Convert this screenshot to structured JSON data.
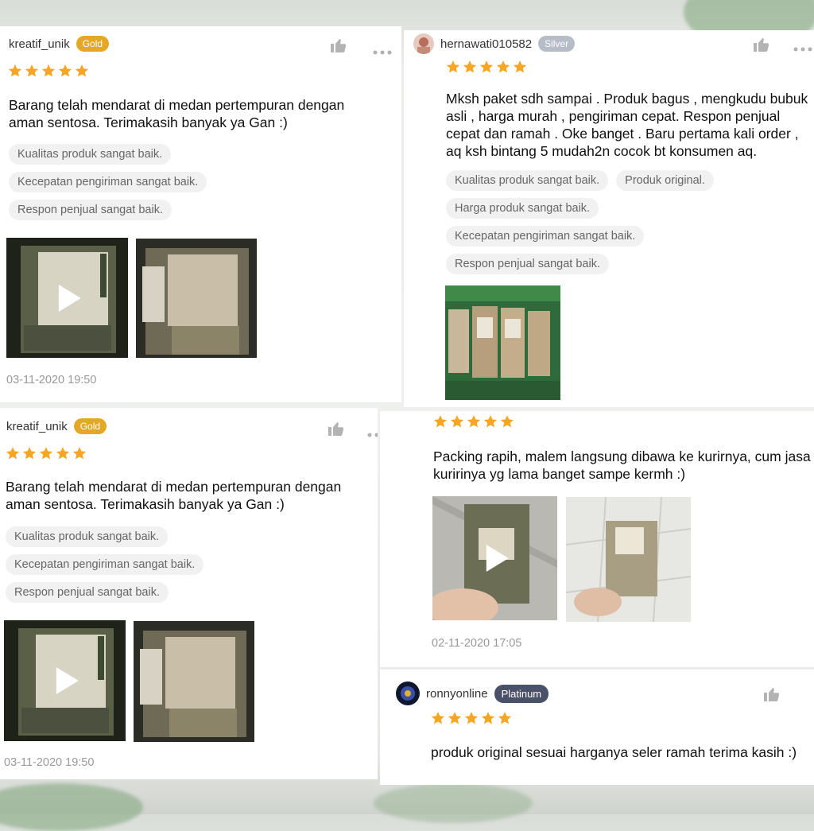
{
  "reviews": [
    {
      "user": "kreatif_unik",
      "badge": "Gold",
      "rating": 5,
      "text": "Barang telah mendarat di medan pertempuran dengan aman sentosa. Terimakasih banyak ya Gan :)",
      "tags": [
        "Kualitas produk sangat baik.",
        "Kecepatan pengiriman sangat baik.",
        "Respon penjual sangat baik."
      ],
      "date": "03-11-2020 19:50"
    },
    {
      "user": "hernawati010582",
      "badge": "Silver",
      "rating": 5,
      "text": "Mksh paket sdh sampai . Produk bagus  , mengkudu bubuk asli , harga murah ,  pengiriman cepat. Respon penjual cepat dan ramah . Oke banget .  Baru pertama kali order , aq ksh bintang 5 mudah2n cocok bt konsumen aq.",
      "tags": [
        "Kualitas produk sangat baik.",
        "Produk original.",
        "Harga produk sangat baik.",
        "Kecepatan pengiriman sangat baik.",
        "Respon penjual sangat baik."
      ]
    },
    {
      "user": "kreatif_unik",
      "badge": "Gold",
      "rating": 5,
      "text": "Barang telah mendarat di medan pertempuran dengan aman sentosa. Terimakasih banyak ya Gan :)",
      "tags": [
        "Kualitas produk sangat baik.",
        "Kecepatan pengiriman sangat baik.",
        "Respon penjual sangat baik."
      ],
      "date": "03-11-2020 19:50"
    },
    {
      "rating": 5,
      "text": "Packing rapih, malem langsung dibawa ke kurirnya, cum jasa kuririnya yg lama banget sampe kermh :)",
      "date": "02-11-2020 17:05"
    },
    {
      "user": "ronnyonline",
      "badge": "Platinum",
      "rating": 5,
      "text": "produk original sesuai harganya seler ramah terima kasih :)"
    }
  ],
  "icons": {
    "like": "thumbs-up-icon",
    "more": "more-dots-icon",
    "star": "star-icon",
    "play": "play-icon"
  },
  "colors": {
    "star": "#f6a623",
    "gold_badge": "#e3a926",
    "silver_badge": "#b7bdc6",
    "platinum_badge": "#4a5168",
    "tag_bg": "#f1f1f1",
    "date": "#999999"
  }
}
